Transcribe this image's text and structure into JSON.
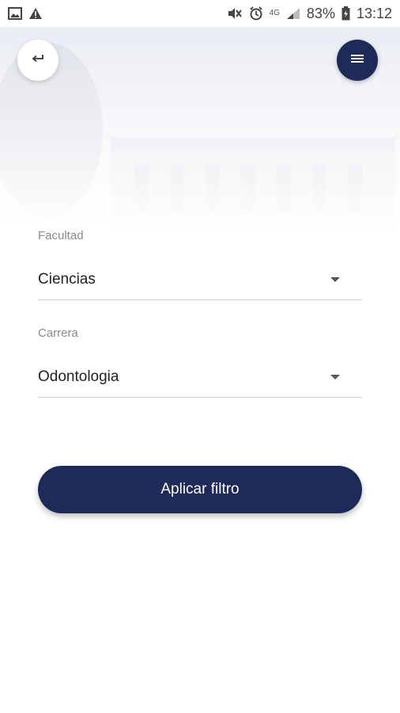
{
  "status_bar": {
    "battery": "83%",
    "time": "13:12",
    "network": "4G",
    "icons": [
      "image-icon",
      "warning-icon",
      "mute-icon",
      "alarm-icon",
      "signal-icon",
      "battery-icon"
    ]
  },
  "header": {
    "back_icon": "back-arrow-icon",
    "menu_icon": "hamburger-menu-icon"
  },
  "form": {
    "faculty_label": "Facultad",
    "faculty_value": "Ciencias",
    "career_label": "Carrera",
    "career_value": "Odontologia"
  },
  "actions": {
    "apply_label": "Aplicar filtro"
  },
  "colors": {
    "primary": "#1e2a57",
    "background": "#ffffff"
  }
}
